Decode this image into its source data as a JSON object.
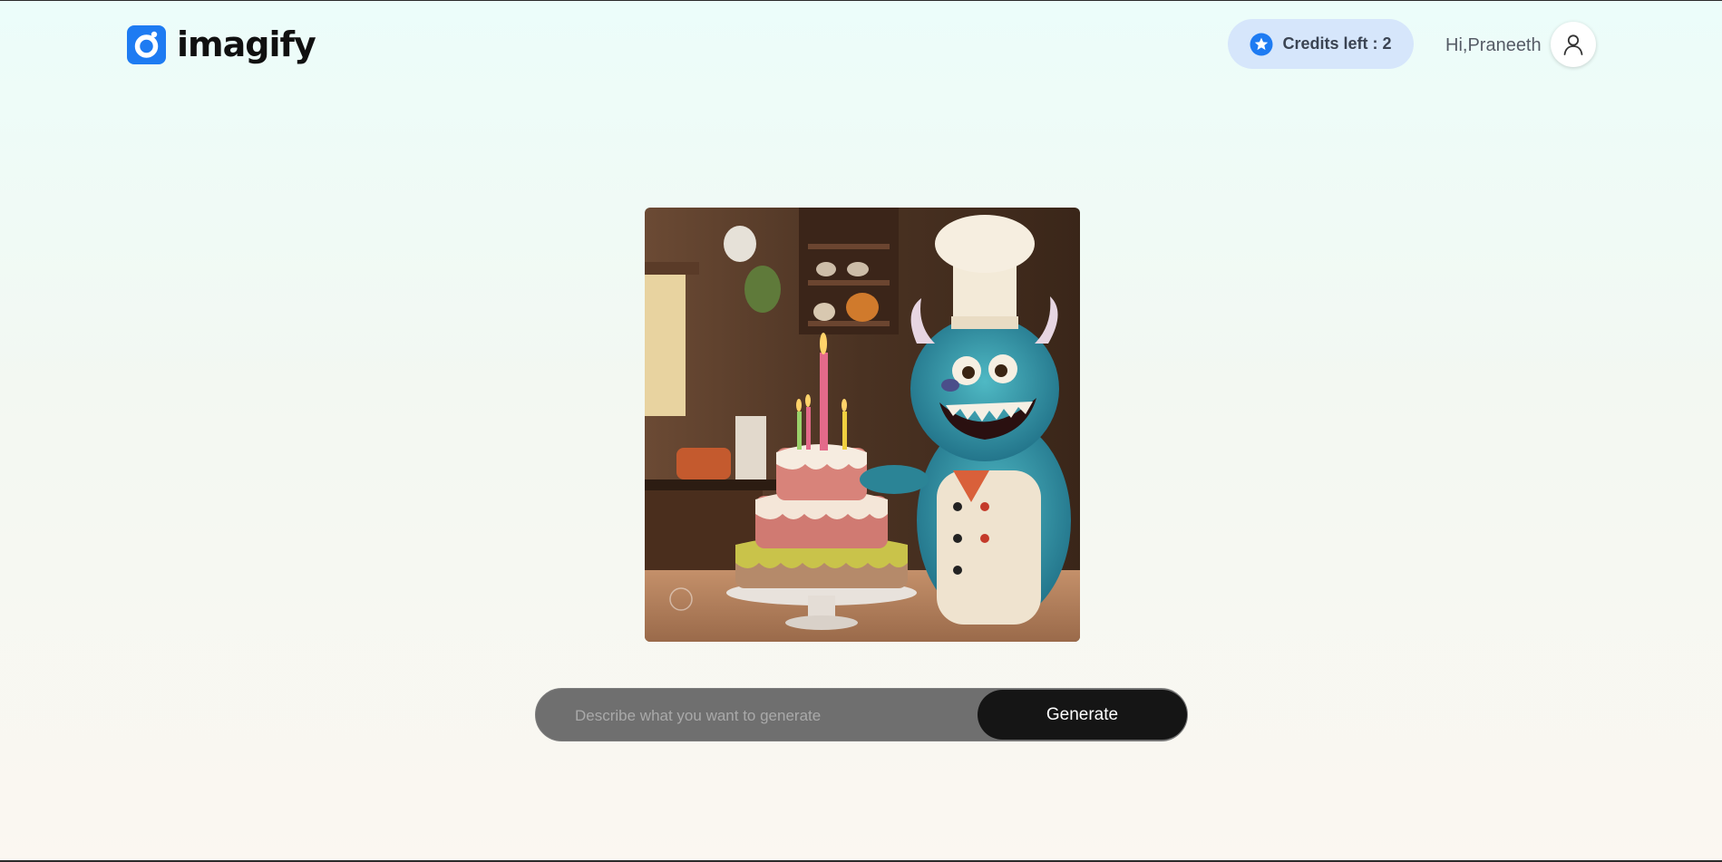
{
  "header": {
    "logo_text": "imagify",
    "credits_label": "Credits left : 2",
    "greeting": "Hi,Praneeth"
  },
  "prompt": {
    "placeholder": "Describe what you want to generate",
    "value": "",
    "button_label": "Generate"
  },
  "image": {
    "alt": "generated image"
  },
  "colors": {
    "brand": "#1e7bf2",
    "credits_bg": "#d6e6fb",
    "button_bg": "#151515",
    "input_bg": "#6f6f6f"
  },
  "icons": {
    "logo": "logo-icon",
    "credits": "star-badge-icon",
    "avatar": "user-icon"
  }
}
